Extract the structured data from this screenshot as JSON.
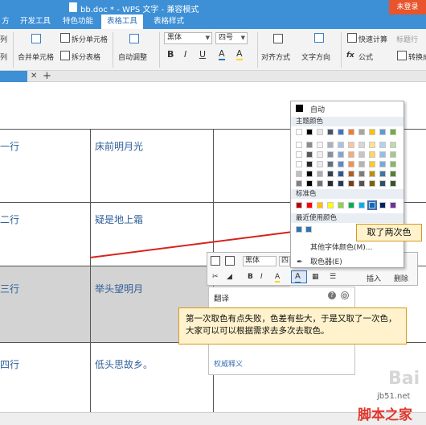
{
  "titlebar": {
    "title": "bb.doc * - WPS 文字 - 兼容模式",
    "unlogged": "未登录"
  },
  "menu_tabs": [
    "方",
    "开发工具",
    "特色功能",
    "表格工具",
    "表格样式"
  ],
  "active_tab": "表格工具",
  "ribbon": {
    "left_partial": [
      "列",
      "列"
    ],
    "merge_cells": "合并单元格",
    "split_cells": "拆分单元格",
    "split_table": "拆分表格",
    "auto_adjust": "自动调整",
    "font_name": "黑体",
    "font_size": "四号",
    "format_buttons": [
      "B",
      "I",
      "U",
      "A",
      "A"
    ],
    "align": "对齐方式",
    "text_direction": "文字方向",
    "formula": "公式",
    "quick_calc": "快速计算",
    "title_row": "标题行",
    "convert": "转换成"
  },
  "table": {
    "col1": [
      "一行",
      "二行",
      "三行",
      "四行"
    ],
    "col2": [
      "床前明月光",
      "疑是地上霜",
      "举头望明月",
      "低头思故乡。"
    ]
  },
  "color_panel": {
    "auto_label": "自动",
    "theme_label": "主题颜色",
    "standard_label": "标准色",
    "recent_label": "最近使用颜色",
    "more_colors": "其他字体颜色(M)...",
    "picker": "取色器(E)",
    "theme_top": [
      "#ffffff",
      "#000000",
      "#e6e6e6",
      "#44546a",
      "#4472c4",
      "#ed7d31",
      "#a5a5a5",
      "#ffc000",
      "#5b9bd5",
      "#70ad47"
    ],
    "standard": [
      "#c00000",
      "#ff0000",
      "#ffc000",
      "#ffff00",
      "#92d050",
      "#00b050",
      "#00b0f0",
      "#0070c0",
      "#002060",
      "#7030a0"
    ],
    "recent": [
      "#2e75b6",
      "#2e75b6"
    ]
  },
  "mini_toolbar": {
    "font": "黑体",
    "size": "四",
    "bold": "B",
    "italic": "I",
    "insert": "插入",
    "delete": "删除"
  },
  "translate_panel": {
    "title": "翻译",
    "link": "权威释义"
  },
  "callouts": {
    "twice": "取了两次色",
    "note": "第一次取色有点失败，色差有些大，于是又取了一次色，大家可以可以根据需求去多次去取色。"
  },
  "watermark": {
    "site": "jb51.net",
    "brand": "脚本之家",
    "baidu": "Bai"
  }
}
